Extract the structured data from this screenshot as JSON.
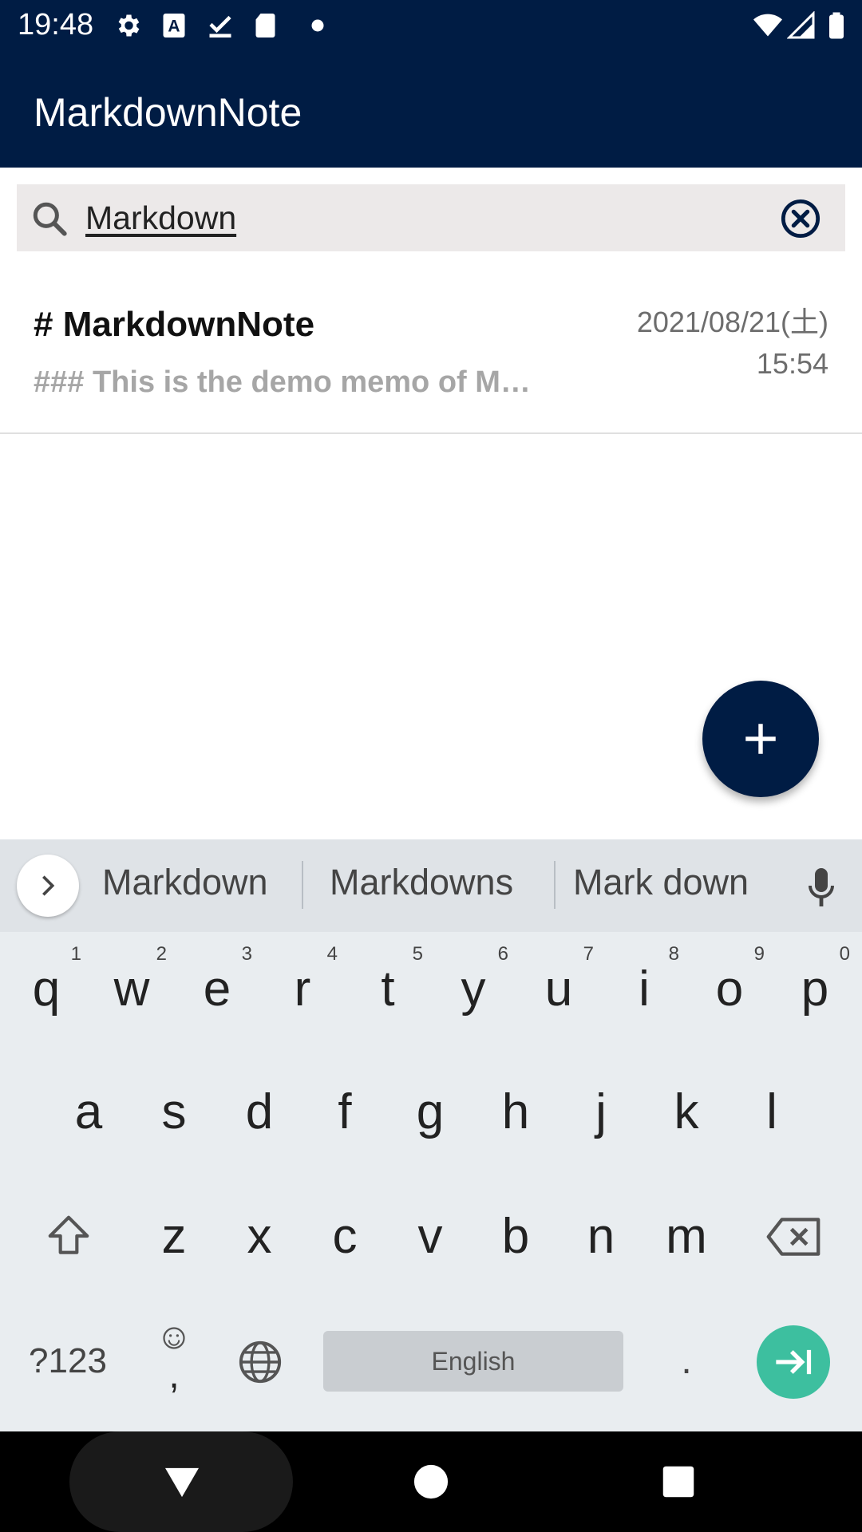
{
  "status_bar": {
    "time": "19:48",
    "icons": [
      "settings-icon",
      "keyboard-a-icon",
      "download-check-icon",
      "sd-card-icon",
      "dot-icon",
      "wifi-icon",
      "signal-icon",
      "battery-icon"
    ]
  },
  "app_bar": {
    "title": "MarkdownNote"
  },
  "search": {
    "value": "Markdown",
    "icon": "search-icon",
    "clear_icon": "clear-icon"
  },
  "notes": [
    {
      "title": "# MarkdownNote",
      "preview": "### This is the demo memo of M…",
      "date": "2021/08/21(土)",
      "time": "15:54"
    }
  ],
  "fab": {
    "icon": "plus-icon"
  },
  "keyboard": {
    "suggestions": [
      "Markdown",
      "Markdowns",
      "Mark down"
    ],
    "row1": [
      "q",
      "w",
      "e",
      "r",
      "t",
      "y",
      "u",
      "i",
      "o",
      "p"
    ],
    "row1_hints": [
      "1",
      "2",
      "3",
      "4",
      "5",
      "6",
      "7",
      "8",
      "9",
      "0"
    ],
    "row2": [
      "a",
      "s",
      "d",
      "f",
      "g",
      "h",
      "j",
      "k",
      "l"
    ],
    "row3": [
      "z",
      "x",
      "c",
      "v",
      "b",
      "n",
      "m"
    ],
    "symbols_label": "?123",
    "comma_label": ",",
    "period_label": ".",
    "space_label": "English",
    "colors": {
      "enter_key": "#3dbf9f",
      "background": "#e9edf0"
    }
  },
  "colors": {
    "app_bar": "#001c44",
    "fab": "#001c44"
  }
}
